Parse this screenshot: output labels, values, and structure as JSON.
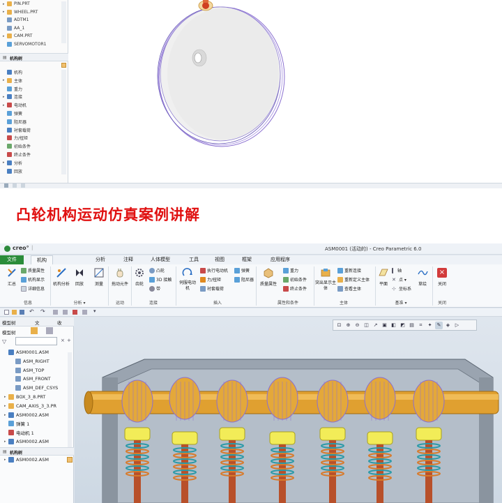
{
  "top_screenshot": {
    "tree_items": [
      {
        "label": "PIN.PRT",
        "expand": "▸",
        "color": "#e9b04a"
      },
      {
        "label": "WHEEL.PRT",
        "expand": "▸",
        "color": "#e9b04a"
      },
      {
        "label": "ADTM1",
        "expand": "",
        "color": "#7a9bc4"
      },
      {
        "label": "AA_1",
        "expand": "",
        "color": "#7a9bc4"
      },
      {
        "label": "CAM.PRT",
        "expand": "▸",
        "color": "#e9b04a"
      },
      {
        "label": "SERVOMOTOR1",
        "expand": "",
        "color": "#5aa0d8"
      }
    ],
    "mech_tree_title": "机构树",
    "mech_items": [
      {
        "label": "机构",
        "expand": "",
        "color": "#4a7fc1"
      },
      {
        "label": "主体",
        "expand": "▸",
        "color": "#e9b04a"
      },
      {
        "label": "重力",
        "expand": "",
        "color": "#5aa0d8"
      },
      {
        "label": "连接",
        "expand": "▸",
        "color": "#4a7fc1"
      },
      {
        "label": "电动机",
        "expand": "▸",
        "color": "#c84a4a"
      },
      {
        "label": "弹簧",
        "expand": "",
        "color": "#5aa0d8"
      },
      {
        "label": "阻尼器",
        "expand": "",
        "color": "#5aa0d8"
      },
      {
        "label": "衬套载荷",
        "expand": "",
        "color": "#4a7fc1"
      },
      {
        "label": "力/扭矩",
        "expand": "",
        "color": "#c84a4a"
      },
      {
        "label": "初始条件",
        "expand": "",
        "color": "#6aa86a"
      },
      {
        "label": "终止条件",
        "expand": "",
        "color": "#c84a4a"
      },
      {
        "label": "分析",
        "expand": "▸",
        "color": "#4a7fc1"
      },
      {
        "label": "回放",
        "expand": "",
        "color": "#4a7fc1"
      }
    ]
  },
  "caption": "凸轮机构运动仿真案例讲解",
  "creo": {
    "logo": "creo°",
    "window_title": "ASM0001 (活动的) - Creo Parametric 6.0",
    "tabs": [
      "文件",
      "机构",
      "分析",
      "注释",
      "人体模型",
      "工具",
      "视图",
      "框架",
      "应用程序"
    ],
    "active_tab": "机构",
    "ribbon": {
      "info_group": {
        "label": "信息",
        "big": "汇总",
        "small": [
          "质量属性",
          "机构显示",
          "详细信息"
        ]
      },
      "analysis_group": {
        "label": "分析 ▾",
        "buttons": [
          "机构分析",
          "回放",
          "测量"
        ]
      },
      "motion_group": {
        "label": "运动",
        "button": "拖动元件"
      },
      "connect_group": {
        "label": "连接",
        "big": "齿轮",
        "small": [
          "凸轮",
          "3D 接触",
          "带"
        ]
      },
      "insert_group": {
        "label": "插入",
        "big": "伺服电动机",
        "small": [
          "执行电动机",
          "力/扭矩",
          "衬套载荷",
          "弹簧",
          "阻尼器"
        ]
      },
      "props_group": {
        "label": "属性和条件",
        "big": "质量属性",
        "small": [
          "重力",
          "初始条件",
          "终止条件"
        ]
      },
      "body_group": {
        "label": "主体",
        "big": "突出显示主体",
        "small": [
          "重新连接",
          "重新定义主体",
          "查看主体"
        ]
      },
      "datum_group": {
        "label": "基准 ▾",
        "big": "平面",
        "small": [
          "轴",
          "点 ▾",
          "坐标系"
        ],
        "extra": "草绘"
      },
      "close_group": {
        "label": "关闭",
        "button": "关闭"
      }
    },
    "model_tree": {
      "tabs": [
        "模型树",
        "文",
        "收"
      ],
      "title": "模型树",
      "items": [
        {
          "label": "ASM0001.ASM",
          "expand": "",
          "color": "#4a7fc1",
          "indent": 0
        },
        {
          "label": "ASM_RIGHT",
          "expand": "",
          "color": "#7a9bc4",
          "indent": 1
        },
        {
          "label": "ASM_TOP",
          "expand": "",
          "color": "#7a9bc4",
          "indent": 1
        },
        {
          "label": "ASM_FRONT",
          "expand": "",
          "color": "#7a9bc4",
          "indent": 1
        },
        {
          "label": "ASM_DEF_CSYS",
          "expand": "",
          "color": "#7a9bc4",
          "indent": 1
        },
        {
          "label": "BOX_3_8.PRT",
          "expand": "▸",
          "color": "#e9b04a",
          "indent": 0
        },
        {
          "label": "CAM_AXIS_3_3.PR",
          "expand": "▸",
          "color": "#e9b04a",
          "indent": 0
        },
        {
          "label": "ASM0002.ASM",
          "expand": "▸",
          "color": "#4a7fc1",
          "indent": 0
        },
        {
          "label": "弹簧 1",
          "expand": "",
          "color": "#5aa0d8",
          "indent": 0
        },
        {
          "label": "电动机 1",
          "expand": "",
          "color": "#c84a4a",
          "indent": 0
        },
        {
          "label": "ASM0002.ASM",
          "expand": "▸",
          "color": "#4a7fc1",
          "indent": 0
        },
        {
          "label": "ASM0002.ASM",
          "expand": "▸",
          "color": "#4a7fc1",
          "indent": 0
        },
        {
          "label": "ASM0002.ASM",
          "expand": "▸",
          "color": "#4a7fc1",
          "indent": 0
        }
      ],
      "mech_tree_title": "机构树"
    }
  }
}
